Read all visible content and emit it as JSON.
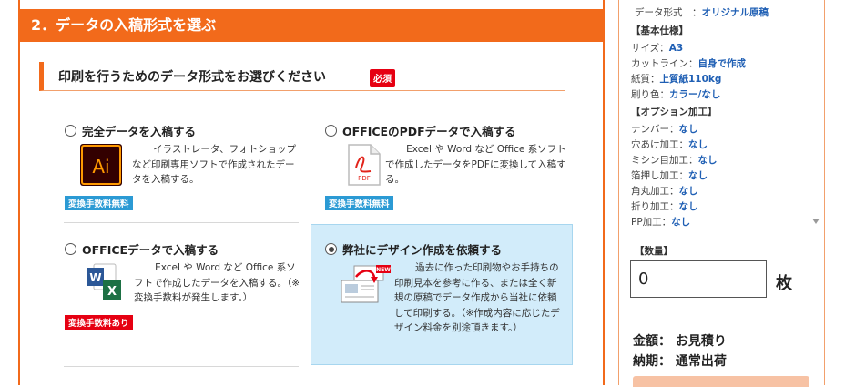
{
  "section": {
    "title": "2．データの入稿形式を選ぶ"
  },
  "subsection": {
    "title": "印刷を行うためのデータ形式をお選びください",
    "required_badge": "必須"
  },
  "options": [
    {
      "title": "完全データを入稿する",
      "desc": "イラストレータ、フォトショップなど印刷専用ソフトで作成されたデータを入稿する。",
      "badge": "変換手数料無料",
      "icon": "illustrator-icon",
      "selected": false
    },
    {
      "title": "OFFICEのPDFデータで入稿する",
      "desc": "Excel や Word など Office 系ソフトで作成したデータをPDFに変換して入稿する。",
      "badge": "変換手数料無料",
      "icon": "pdf-icon",
      "selected": false
    },
    {
      "title": "OFFICEデータで入稿する",
      "desc": "Excel や Word など Office 系ソフトで作成したデータを入稿する。（※変換手数料が発生します。）",
      "badge": "変換手数料あり",
      "icon": "office-icon",
      "selected": false
    },
    {
      "title": "弊社にデザイン作成を依頼する",
      "desc": "過去に作った印刷物やお手持ちの印刷見本を参考に作る、または全く新規の原稿でデータ作成から当社に依頼して印刷する。（※作成内容に応じたデザイン料金を別途頂きます。）",
      "badge": "",
      "icon": "design-request-icon",
      "selected": true
    }
  ],
  "icons": {
    "ai_text": "Ai",
    "pdf_text": "PDF",
    "new_text": "NEW"
  },
  "colors": {
    "accent": "#f26a1b",
    "value_blue": "#1f5fb4",
    "badge_blue": "#2b9ad4",
    "badge_red": "#e60012",
    "selected_bg": "#d2ecfa"
  },
  "summary": {
    "data_format": {
      "label": "データ形式　：",
      "value": "オリジナル原稿"
    },
    "basic_head": "【基本仕様】",
    "basic": [
      {
        "label": "サイズ：",
        "value": "A3"
      },
      {
        "label": "カットライン：",
        "value": "自身で作成"
      },
      {
        "label": "紙質：",
        "value": "上質紙110kg"
      },
      {
        "label": "刷り色：",
        "value": "カラー/なし"
      }
    ],
    "option_head": "【オプション加工】",
    "options": [
      {
        "label": "ナンバー：",
        "value": "なし"
      },
      {
        "label": "穴あけ加工：",
        "value": "なし"
      },
      {
        "label": "ミシン目加工：",
        "value": "なし"
      },
      {
        "label": "箔押し加工：",
        "value": "なし"
      },
      {
        "label": "角丸加工：",
        "value": "なし"
      },
      {
        "label": "折り加工：",
        "value": "なし"
      },
      {
        "label": "PP加工：",
        "value": "なし"
      }
    ],
    "quantity_label": "【数量】",
    "quantity_value": "0",
    "quantity_unit": "枚",
    "price_label": "金額：",
    "price_value": "お見積り",
    "delivery_label": "納期：",
    "delivery_value": "通常出荷"
  }
}
